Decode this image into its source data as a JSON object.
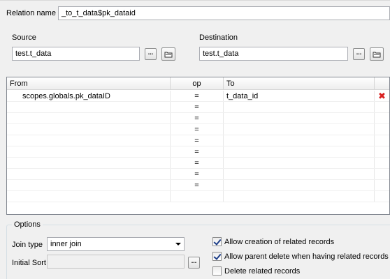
{
  "relation_name": {
    "label": "Relation name",
    "value": "_to_t_data$pk_dataid"
  },
  "source": {
    "label": "Source",
    "value": "test.t_data",
    "browse_label": "...",
    "open_icon": "folder-icon"
  },
  "destination": {
    "label": "Destination",
    "value": "test.t_data",
    "browse_label": "...",
    "open_icon": "folder-icon"
  },
  "grid": {
    "columns": {
      "from": "From",
      "op": "op",
      "to": "To"
    },
    "rows": [
      {
        "from": "scopes.globals.pk_dataID",
        "op": "=",
        "to": "t_data_id",
        "delete": true
      },
      {
        "from": "",
        "op": "=",
        "to": ""
      },
      {
        "from": "",
        "op": "=",
        "to": ""
      },
      {
        "from": "",
        "op": "=",
        "to": ""
      },
      {
        "from": "",
        "op": "=",
        "to": ""
      },
      {
        "from": "",
        "op": "=",
        "to": ""
      },
      {
        "from": "",
        "op": "=",
        "to": ""
      },
      {
        "from": "",
        "op": "=",
        "to": ""
      },
      {
        "from": "",
        "op": "=",
        "to": ""
      },
      {
        "from": "",
        "op": "",
        "to": ""
      }
    ],
    "delete_icon": "close-x-icon",
    "delete_color": "#d92020"
  },
  "options": {
    "title": "Options",
    "join_type_label": "Join type",
    "join_type_value": "inner join",
    "initial_sort_label": "Initial Sort",
    "initial_sort_value": "",
    "initial_sort_button": "...",
    "checkboxes": [
      {
        "label": "Allow creation of related records",
        "checked": true
      },
      {
        "label": "Allow parent delete when having related records",
        "checked": true
      },
      {
        "label": "Delete related records",
        "checked": false
      }
    ]
  }
}
